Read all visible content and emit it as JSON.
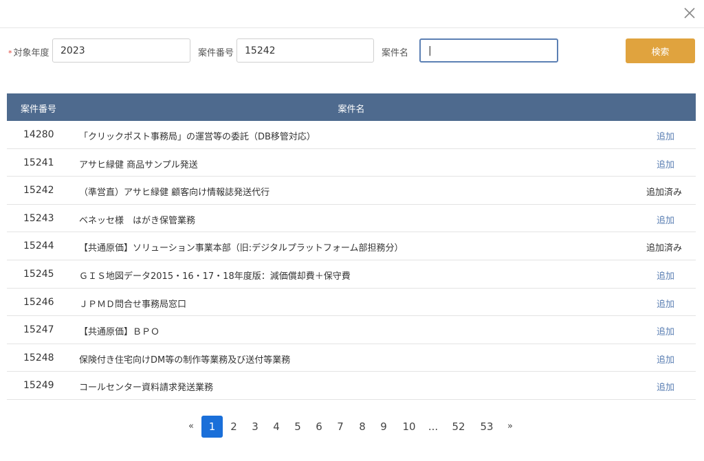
{
  "dialog": {
    "close_icon": "close-icon"
  },
  "search": {
    "year_label": "対象年度",
    "required_mark": "*",
    "year_value": "2023",
    "number_label": "案件番号",
    "number_value": "15242",
    "name_label": "案件名",
    "name_value": "|",
    "search_button": "検索",
    "accent_color": "#e0a33e"
  },
  "table": {
    "header_color": "#4e6a8e",
    "columns": [
      "案件番号",
      "案件名"
    ],
    "rows": [
      {
        "number": "14280",
        "name": "「クリックポスト事務局」の運営等の委託（DB移管対応）",
        "action": "追加",
        "status": "add"
      },
      {
        "number": "15241",
        "name": "アサヒ緑健 商品サンプル発送",
        "action": "追加",
        "status": "add"
      },
      {
        "number": "15242",
        "name": "（準営直）アサヒ緑健 顧客向け情報誌発送代行",
        "action": "追加済み",
        "status": "done"
      },
      {
        "number": "15243",
        "name": "ベネッセ様　はがき保管業務",
        "action": "追加",
        "status": "add"
      },
      {
        "number": "15244",
        "name": "【共通原価】ソリューション事業本部（旧:デジタルプラットフォーム部担務分）",
        "action": "追加済み",
        "status": "done"
      },
      {
        "number": "15245",
        "name": "ＧＩＳ地図データ2015・16・17・18年度版：減価償却費＋保守費",
        "action": "追加",
        "status": "add"
      },
      {
        "number": "15246",
        "name": "ＪＰＭＤ問合せ事務局窓口",
        "action": "追加",
        "status": "add"
      },
      {
        "number": "15247",
        "name": "【共通原価】ＢＰＯ",
        "action": "追加",
        "status": "add"
      },
      {
        "number": "15248",
        "name": "保険付き住宅向けDM等の制作等業務及び送付等業務",
        "action": "追加",
        "status": "add"
      },
      {
        "number": "15249",
        "name": "コールセンター資料請求発送業務",
        "action": "追加",
        "status": "add"
      }
    ]
  },
  "pagination": {
    "prev": "«",
    "next": "»",
    "ellipsis": "...",
    "current": "1",
    "pages": [
      "1",
      "2",
      "3",
      "4",
      "5",
      "6",
      "7",
      "8",
      "9",
      "10",
      "52",
      "53"
    ],
    "active_color": "#1a6fd9"
  }
}
